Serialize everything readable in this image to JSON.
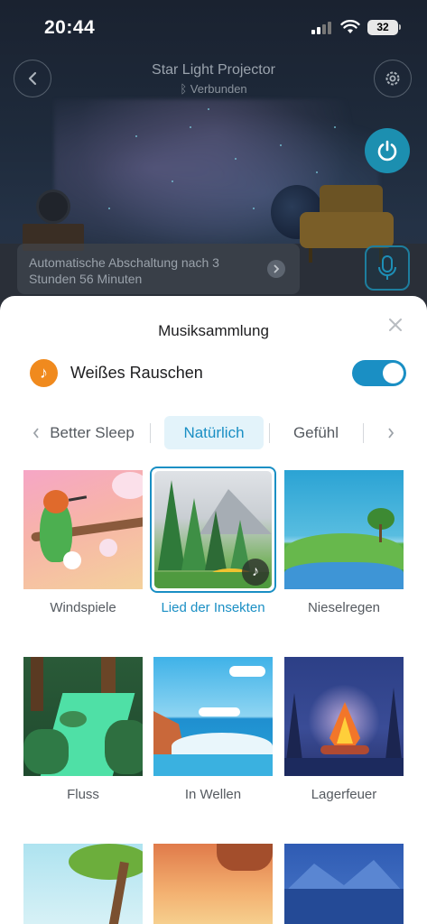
{
  "status_bar": {
    "time": "20:44",
    "battery": "32"
  },
  "device": {
    "title": "Star Light Projector",
    "connection": "Verbunden"
  },
  "timer_notice": "Automatische Abschaltung nach 3 Stunden 56 Minuten",
  "sheet": {
    "title": "Musiksammlung",
    "white_noise_label": "Weißes Rauschen",
    "white_noise_enabled": true,
    "tabs": [
      {
        "label": "Better Sleep",
        "active": false
      },
      {
        "label": "Natürlich",
        "active": true
      },
      {
        "label": "Gefühl",
        "active": false
      }
    ],
    "items": [
      {
        "label": "Windspiele",
        "selected": false
      },
      {
        "label": "Lied der Insekten",
        "selected": true
      },
      {
        "label": "Nieselregen",
        "selected": false
      },
      {
        "label": "Fluss",
        "selected": false
      },
      {
        "label": "In Wellen",
        "selected": false
      },
      {
        "label": "Lagerfeuer",
        "selected": false
      }
    ]
  },
  "colors": {
    "accent": "#1a8fc4",
    "white_noise_icon": "#f08a1e",
    "power_button": "#1c8fb0"
  },
  "icons": [
    "back-chevron-icon",
    "gear-icon",
    "bluetooth-icon",
    "power-icon",
    "microphone-icon",
    "close-icon",
    "music-note-icon",
    "chevron-left-icon",
    "chevron-right-icon"
  ]
}
